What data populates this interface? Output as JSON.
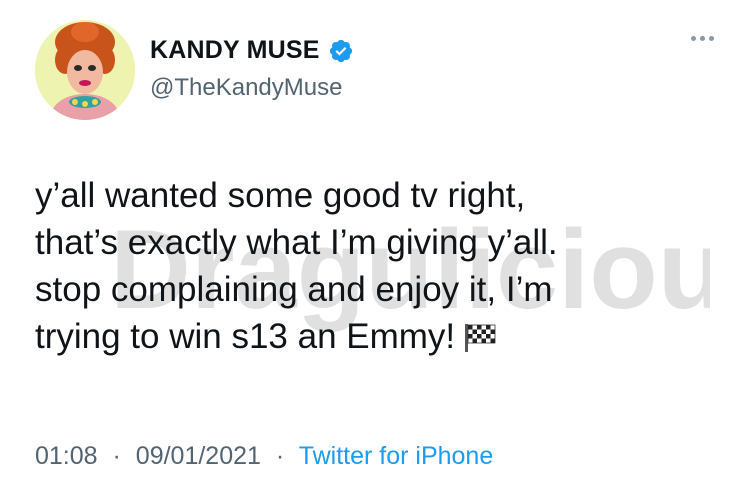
{
  "author": {
    "display_name": "KANDY MUSE",
    "handle": "@TheKandyMuse",
    "verified": true
  },
  "tweet": {
    "lines": [
      "y’all wanted some good tv right,",
      "that’s exactly what I’m giving y’all.",
      "stop complaining and enjoy it, I’m",
      "trying to win s13 an Emmy!"
    ],
    "emoji": "checkered-flag-icon"
  },
  "meta": {
    "time": "01:08",
    "separator": "·",
    "date": "09/01/2021",
    "source": "Twitter for iPhone"
  },
  "watermark": {
    "text": "Dragulicious"
  },
  "colors": {
    "text": "#0f1419",
    "secondary": "#536471",
    "accent": "#1d9bf0",
    "watermark": "#c8c8c8"
  }
}
